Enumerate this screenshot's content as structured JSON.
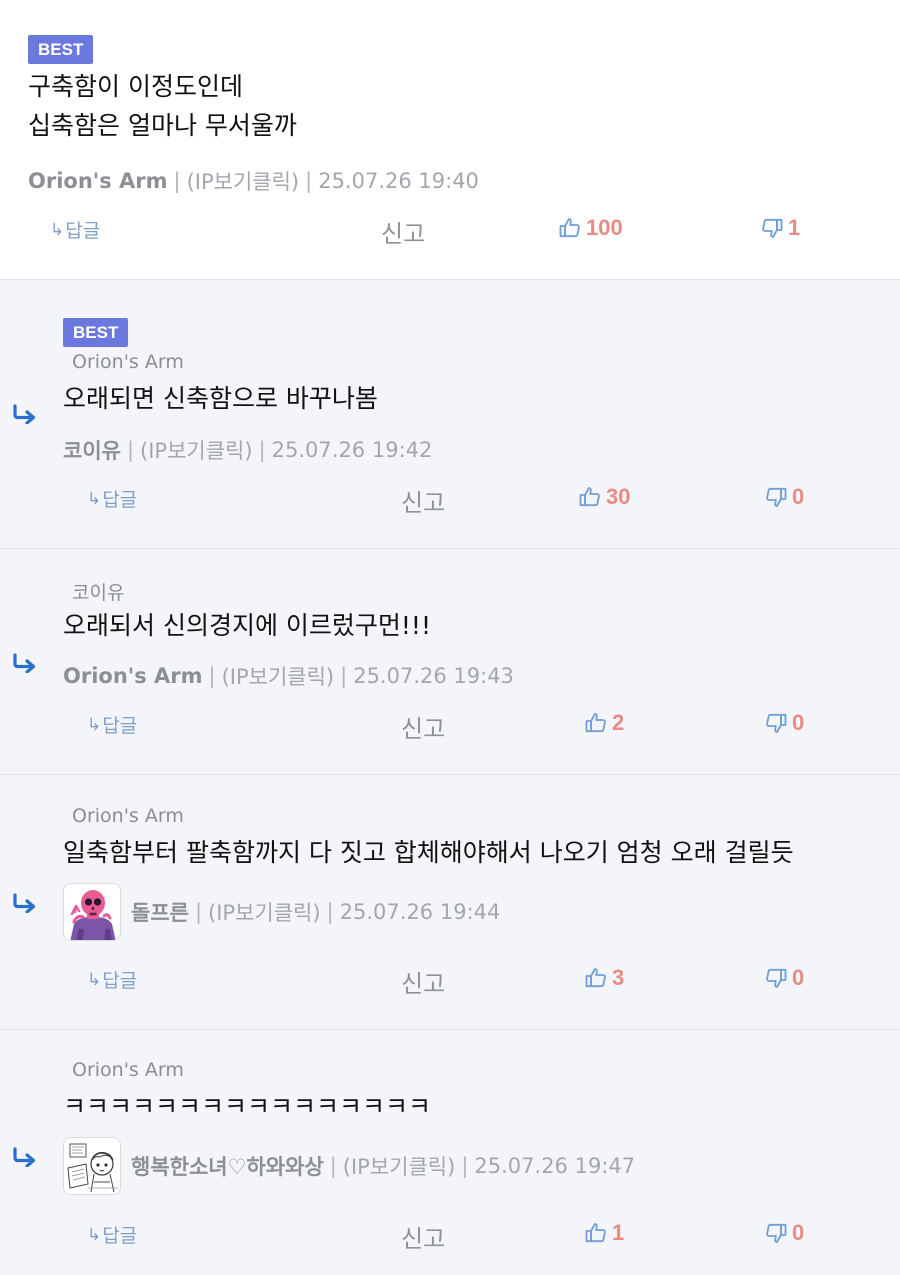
{
  "labels": {
    "reply": "답글",
    "report": "신고",
    "best": "BEST",
    "ip": "(IP보기클릭)",
    "divider": "|"
  },
  "colors": {
    "best_bg": "#6b79de",
    "reply_arrow": "#2a6fc9",
    "count": "#e88b86",
    "thumb": "#6f9fd6"
  },
  "comments": [
    {
      "best": true,
      "text_lines": [
        "구축함이 이정도인데",
        "십축함은 얼마나 무서울까"
      ],
      "author": "Orion's Arm",
      "time": "25.07.26 19:40",
      "likes": "100",
      "dislikes": "1"
    },
    {
      "best": true,
      "reply_to": "Orion's Arm",
      "text": "오래되면 신축함으로 바꾸나봄",
      "author": "코이유",
      "time": "25.07.26 19:42",
      "likes": "30",
      "dislikes": "0"
    },
    {
      "reply_to": "코이유",
      "text": "오래되서 신의경지에 이르렀구먼!!!",
      "author": "Orion's Arm",
      "time": "25.07.26 19:43",
      "likes": "2",
      "dislikes": "0"
    },
    {
      "reply_to": "Orion's Arm",
      "text": "일축함부터 팔축함까지 다 짓고 합체해야해서 나오기 엄청 오래 걸릴듯",
      "author": "돌프른",
      "avatar": "skull-avatar",
      "time": "25.07.26 19:44",
      "likes": "3",
      "dislikes": "0"
    },
    {
      "reply_to": "Orion's Arm",
      "text": "ㅋㅋㅋㅋㅋㅋㅋㅋㅋㅋㅋㅋㅋㅋㅋㅋ",
      "author": "행복한소녀♡하와와상",
      "avatar": "sketch-girl-avatar",
      "time": "25.07.26 19:47",
      "likes": "1",
      "dislikes": "0"
    }
  ]
}
